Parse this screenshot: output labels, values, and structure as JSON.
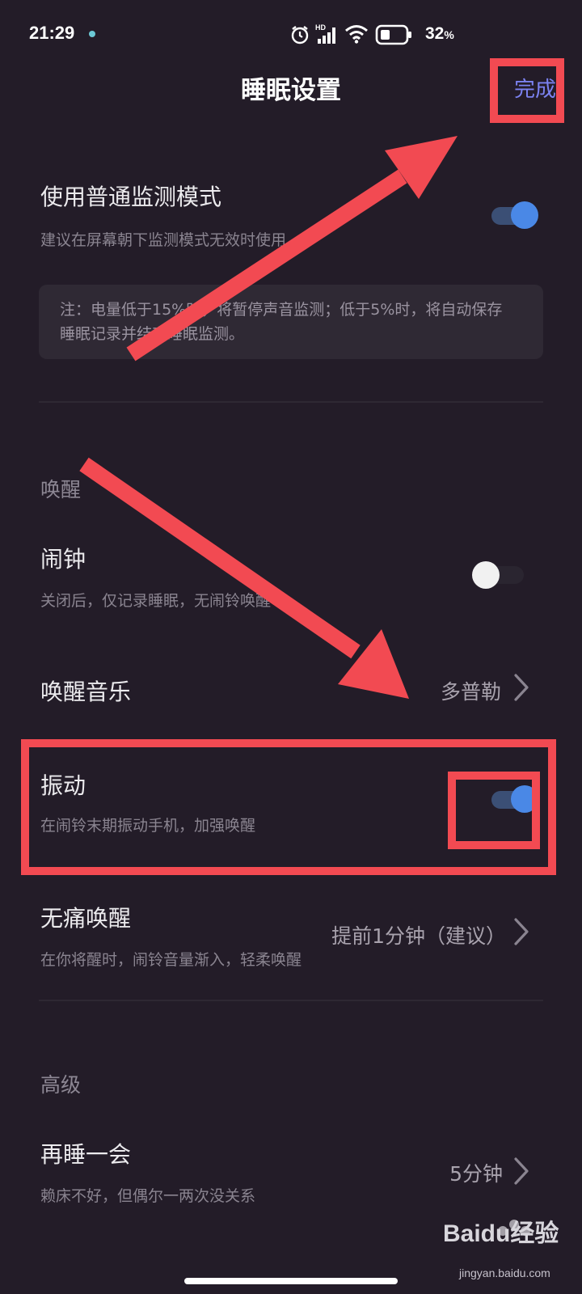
{
  "status_bar": {
    "time": "21:29",
    "battery": "32",
    "battery_unit": "%"
  },
  "header": {
    "title": "睡眠设置",
    "done_label": "完成"
  },
  "monitor": {
    "title": "使用普通监测模式",
    "desc": "建议在屏幕朝下监测模式无效时使用",
    "toggle_on": true,
    "note_line1": "注：电量低于15%时，将暂停声音监测；低于5%时，将自动保存",
    "note_line2": "睡眠记录并结束睡眠监测。"
  },
  "wake_section": {
    "label": "唤醒",
    "alarm": {
      "title": "闹钟",
      "desc": "关闭后，仅记录睡眠，无闹铃唤醒",
      "toggle_on": false
    },
    "music": {
      "title": "唤醒音乐",
      "value": "多普勒"
    },
    "vibrate": {
      "title": "振动",
      "desc": "在闹铃末期振动手机，加强唤醒",
      "toggle_on": true
    },
    "gentle": {
      "title": "无痛唤醒",
      "desc": "在你将醒时，闹铃音量渐入，轻柔唤醒",
      "value": "提前1分钟（建议）"
    }
  },
  "advanced_section": {
    "label": "高级",
    "snooze": {
      "title": "再睡一会",
      "desc": "赖床不好，但偶尔一两次没关系",
      "value": "5分钟"
    }
  },
  "watermark": {
    "text": "Baidu经验",
    "sub": "jingyan.baidu.com"
  },
  "colors": {
    "accent": "#7b82f0",
    "toggle_on": "#4a88e6",
    "annotation": "#f24a52",
    "background": "#231c28"
  }
}
